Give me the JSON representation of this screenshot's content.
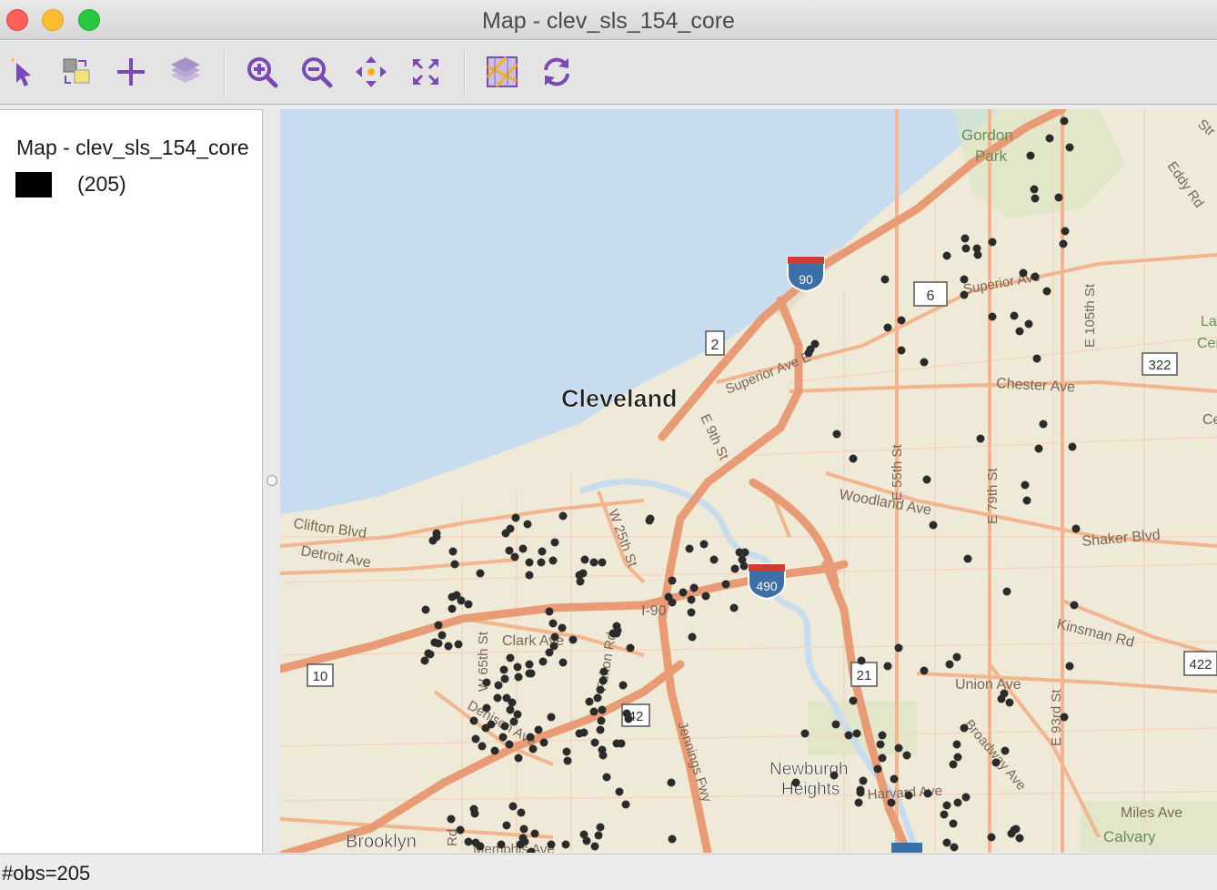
{
  "window": {
    "title": "Map - clev_sls_154_core"
  },
  "toolbar": {
    "tools": [
      {
        "name": "select-tool-icon"
      },
      {
        "name": "selection-shape-icon"
      },
      {
        "name": "add-layer-icon"
      },
      {
        "name": "layers-icon"
      },
      {
        "name": "zoom-in-icon"
      },
      {
        "name": "zoom-out-icon"
      },
      {
        "name": "pan-icon"
      },
      {
        "name": "full-extent-icon"
      },
      {
        "name": "basemap-icon"
      },
      {
        "name": "refresh-icon"
      }
    ]
  },
  "legend": {
    "title": "Map - clev_sls_154_core",
    "categories": [
      {
        "label": "(205)",
        "color": "#000000"
      }
    ]
  },
  "map": {
    "labels": {
      "cleveland": "Cleveland",
      "gordon": "Gordon",
      "park": "Park",
      "eddy_rd": "Eddy Rd",
      "superior_ave_e": "Superior Ave",
      "superior_ave": "Superior Ave E",
      "e105": "E 105th St",
      "chester": "Chester Ave",
      "e9": "E 9th St",
      "e55": "E 55th St",
      "e79": "E 79th St",
      "woodland": "Woodland Ave",
      "shaker": "Shaker Blvd",
      "kinsman": "Kinsman Rd",
      "union": "Union Ave",
      "broadway": "Broadway Ave",
      "e93": "E 93rd St",
      "miles": "Miles Ave",
      "calvary": "Calvary",
      "newburgh1": "Newburgh",
      "newburgh2": "Heights",
      "harvard": "Harvard Ave",
      "jennings": "Jennings Fwy",
      "clark": "Clark Ave",
      "fulton": "Fulton Rd",
      "w65": "W 65th St",
      "denison": "Denison Ave",
      "i90": "I-90",
      "w25": "W 25th St",
      "clifton": "Clifton Blvd",
      "detroit": "Detroit Ave",
      "brooklyn": "Brooklyn",
      "memphis": "Memphis Ave",
      "lake": "Lak",
      "cer": "Cer",
      "cedar": "Ced",
      "str": "Str",
      "rd": "Rd"
    },
    "shields": {
      "interstate_90": "90",
      "interstate_490": "490",
      "us_6": "6",
      "us_322": "322",
      "us_422": "422",
      "route_2": "2",
      "route_10": "10",
      "route_42": "42",
      "route_21": "21"
    },
    "colors": {
      "water": "#c8dcef",
      "land": "#efe9d8",
      "highway": "#e89b74",
      "major_road": "#f2b58e",
      "point": "#2b2b2b"
    }
  },
  "status": {
    "text": "#obs=205"
  }
}
